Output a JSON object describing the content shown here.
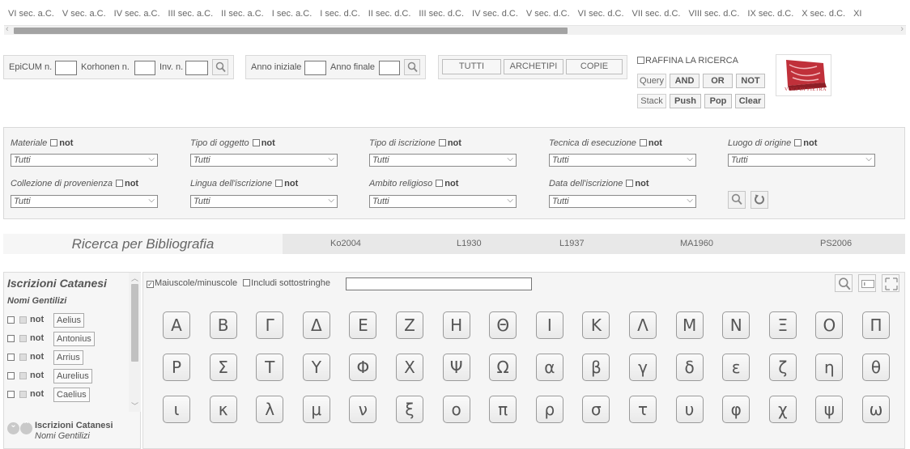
{
  "timeline": {
    "centuries": [
      "VI sec. a.C.",
      "V sec. a.C.",
      "IV sec. a.C.",
      "III sec. a.C.",
      "II sec. a.C.",
      "I sec. a.C.",
      "I sec. d.C.",
      "II sec. d.C.",
      "III sec. d.C.",
      "IV sec. d.C.",
      "V sec. d.C.",
      "VI sec. d.C.",
      "VII sec. d.C.",
      "VIII sec. d.C.",
      "IX sec. d.C.",
      "X sec. d.C.",
      "XI"
    ]
  },
  "search": {
    "epicum_label": "EpiCUM n.",
    "korhonen_label": "Korhonen n.",
    "inv_label": "Inv. n.",
    "year_start_label": "Anno iniziale",
    "year_end_label": "Anno finale",
    "all_button": "TUTTI",
    "archetypes_button": "ARCHETIPI",
    "copies_button": "COPIE",
    "refine_label": "RAFFINA LA RICERCA",
    "query_label": "Query",
    "and_button": "AND",
    "or_button": "OR",
    "not_button": "NOT",
    "stack_label": "Stack",
    "push_button": "Push",
    "pop_button": "Pop",
    "clear_button": "Clear",
    "logo_text": "VOCI DI PIETRA"
  },
  "filters": {
    "not_label": "not",
    "default_value": "Tutti",
    "row1": [
      "Materiale",
      "Tipo di oggetto",
      "Tipo di iscrizione",
      "Tecnica di esecuzione",
      "Luogo di origine"
    ],
    "row2": [
      "Collezione di provenienza",
      "Lingua dell'iscrizione",
      "Ambito religioso",
      "Data dell'iscrizione"
    ]
  },
  "bibliography": {
    "title": "Ricerca per Bibliografia",
    "tabs": [
      "Ko2004",
      "L1930",
      "L1937",
      "MA1960",
      "PS2006"
    ]
  },
  "left_panel": {
    "title": "Iscrizioni Catanesi",
    "subtitle": "Nomi Gentilizi",
    "not_label": "not",
    "names": [
      "Aelius",
      "Antonius",
      "Arrius",
      "Aurelius",
      "Caelius"
    ],
    "footer_title": "Iscrizioni Catanesi",
    "footer_subtitle": "Nomi Gentilizi"
  },
  "keyboard": {
    "case_sensitive_label": "Maiuscole/minuscole",
    "substrings_label": "Includi sottostringhe",
    "row1": [
      "Α",
      "Β",
      "Γ",
      "Δ",
      "Ε",
      "Ζ",
      "Η",
      "Θ",
      "Ι",
      "Κ",
      "Λ",
      "Μ",
      "Ν",
      "Ξ",
      "Ο",
      "Π"
    ],
    "row2": [
      "Ρ",
      "Σ",
      "Τ",
      "Υ",
      "Φ",
      "Χ",
      "Ψ",
      "Ω",
      "α",
      "β",
      "γ",
      "δ",
      "ε",
      "ζ",
      "η",
      "θ"
    ],
    "row3": [
      "ι",
      "κ",
      "λ",
      "μ",
      "ν",
      "ξ",
      "ο",
      "π",
      "ρ",
      "σ",
      "τ",
      "υ",
      "φ",
      "χ",
      "ψ",
      "ω"
    ]
  },
  "icons": {
    "search": "search-icon",
    "reset": "reset-icon",
    "expand": "expand-icon",
    "keyboard_toggle": "keyboard-icon",
    "scroll_down": "chevron-down-icon",
    "scroll_up": "chevron-up-icon"
  },
  "colors": {
    "logo_red": "#c0303a",
    "panel_bg": "#f5f5f5"
  }
}
